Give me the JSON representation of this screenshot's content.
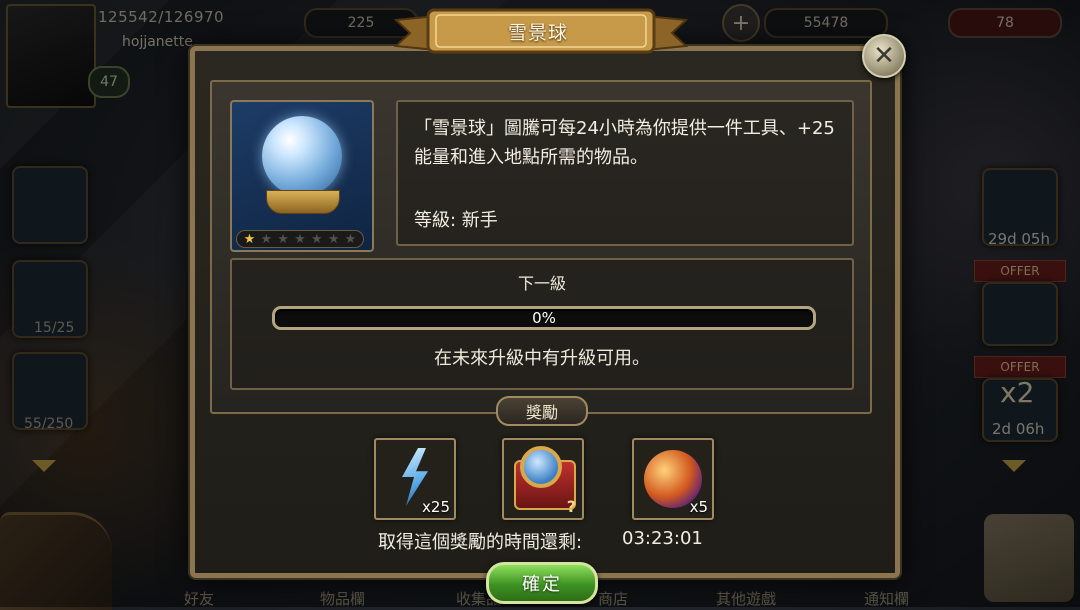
{
  "hud": {
    "xp": "125542/126970",
    "username": "hojjanette",
    "level": "47",
    "currency_a": "225",
    "currency_b": "55478",
    "energy": "78",
    "plus_label": "+"
  },
  "side_left": {
    "tile2_count": "15/25",
    "tile3_count": "55/250"
  },
  "side_right": {
    "timer1": "29d 05h",
    "offer1": "OFFER",
    "offer2": "OFFER",
    "offer2_mult": "x2",
    "timer2": "2d 06h"
  },
  "bottom_tabs": [
    "好友",
    "物品欄",
    "收集品",
    "商店",
    "其他遊戲",
    "通知欄"
  ],
  "modal": {
    "title": "雪景球",
    "close_label": "✕",
    "stars_total": 7,
    "stars_filled": 1,
    "description": "「雪景球」圖騰可每24小時為你提供一件工具、+25能量和進入地點所需的物品。",
    "level_label": "等級: 新手",
    "next_level_title": "下一級",
    "progress_percent": 0,
    "progress_label": "0%",
    "next_level_note": "在未來升級中有升級可用。",
    "rewards_title": "獎勵",
    "rewards": [
      {
        "icon": "energy-bolt-icon",
        "qty": "x25"
      },
      {
        "icon": "mystery-chest-icon",
        "qty": ""
      },
      {
        "icon": "gem-pile-icon",
        "qty": "x5"
      }
    ],
    "time_label": "取得這個獎勵的時間還剩:",
    "time_value": "03:23:01",
    "confirm_label": "確定"
  },
  "colors": {
    "frame_gold": "#8a7550",
    "ribbon_gold": "#c79a4a",
    "confirm_green": "#3e9222",
    "star_on": "#f2c744",
    "star_off": "#555048"
  }
}
